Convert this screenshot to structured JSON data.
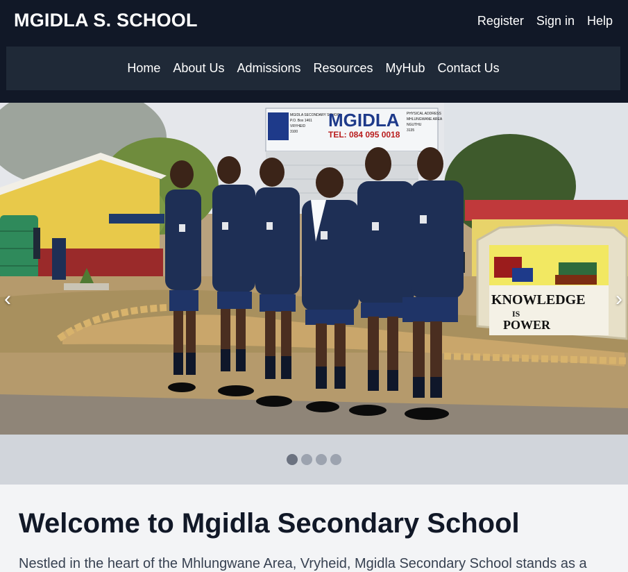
{
  "header": {
    "brand": "MGIDLA S. SCHOOL",
    "top_links": [
      "Register",
      "Sign in",
      "Help"
    ]
  },
  "nav": {
    "items": [
      "Home",
      "About Us",
      "Admissions",
      "Resources",
      "MyHub",
      "Contact Us"
    ]
  },
  "hero": {
    "sign_title": "MGIDLA",
    "sign_phone": "TEL: 084 095 0018",
    "sign_school": "MGIDLA SECONDARY SCHOOL",
    "sign_pobox": "P.O. Box 1461",
    "sign_town": "VRYHEID",
    "sign_code": "3100",
    "sign_addr_label": "PHYSICAL ADDRESS",
    "sign_addr_area": "MHLUNGWANE AREA",
    "sign_addr_town": "NGUTHU",
    "sign_addr_code": "3135",
    "rock_line1": "KNOWLEDGE",
    "rock_line2": "IS",
    "rock_line3": "POWER",
    "prev_arrow": "‹",
    "next_arrow": "›"
  },
  "carousel": {
    "slides": 4,
    "active": 1
  },
  "welcome": {
    "title": "Welcome to Mgidla Secondary School",
    "intro": "Nestled in the heart of the Mhlungwane Area, Vryheid, Mgidla Secondary School stands as a"
  },
  "colors": {
    "header_bg": "#111827",
    "nav_bg": "#1f2937",
    "dots_bar": "#d1d5db",
    "blazer": "#1e2f55"
  }
}
